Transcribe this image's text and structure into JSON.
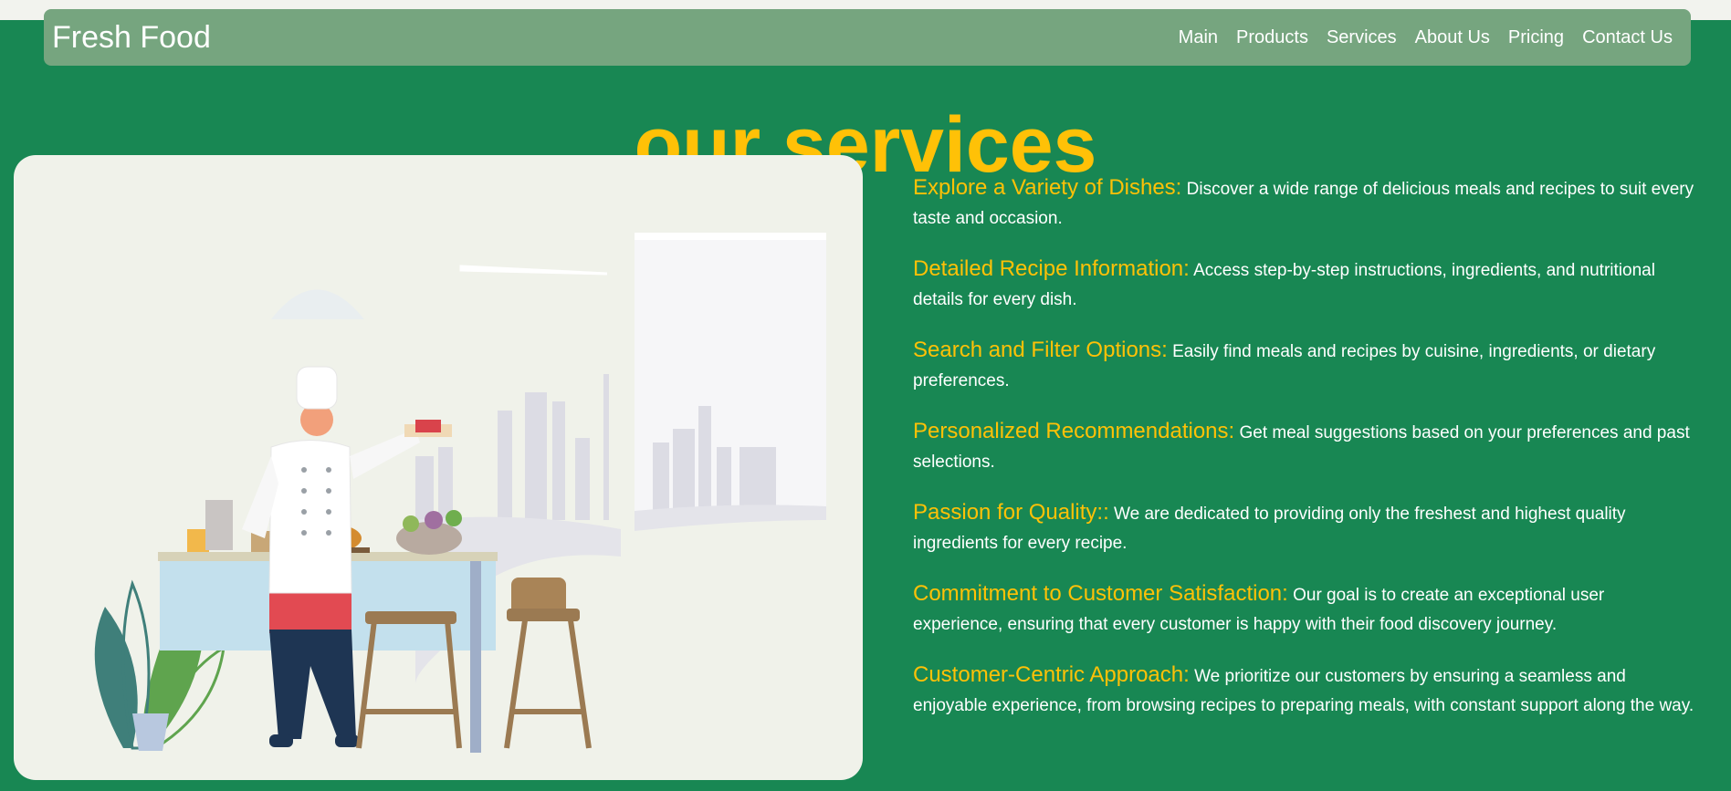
{
  "brand": "Fresh Food",
  "nav": {
    "items": [
      "Main",
      "Products",
      "Services",
      "About Us",
      "Pricing",
      "Contact Us"
    ]
  },
  "heading": "our services",
  "services": [
    {
      "title": "Explore a Variety of Dishes:",
      "text": "Discover a wide range of delicious meals and recipes to suit every taste and occasion."
    },
    {
      "title": "Detailed Recipe Information:",
      "text": "Access step-by-step instructions, ingredients, and nutritional details for every dish."
    },
    {
      "title": "Search and Filter Options:",
      "text": "Easily find meals and recipes by cuisine, ingredients, or dietary preferences."
    },
    {
      "title": "Personalized Recommendations:",
      "text": "Get meal suggestions based on your preferences and past selections."
    },
    {
      "title": "Passion for Quality::",
      "text": "We are dedicated to providing only the freshest and highest quality ingredients for every recipe."
    },
    {
      "title": "Commitment to Customer Satisfaction:",
      "text": "Our goal is to create an exceptional user experience, ensuring that every customer is happy with their food discovery journey."
    },
    {
      "title": "Customer-Centric Approach:",
      "text": "We prioritize our customers by ensuring a seamless and enjoyable experience, from browsing recipes to preparing meals, with constant support along the way."
    }
  ],
  "colors": {
    "background": "#188753",
    "navbar": "#76a57f",
    "accent": "#ffc107",
    "card": "#f0f2ea"
  }
}
